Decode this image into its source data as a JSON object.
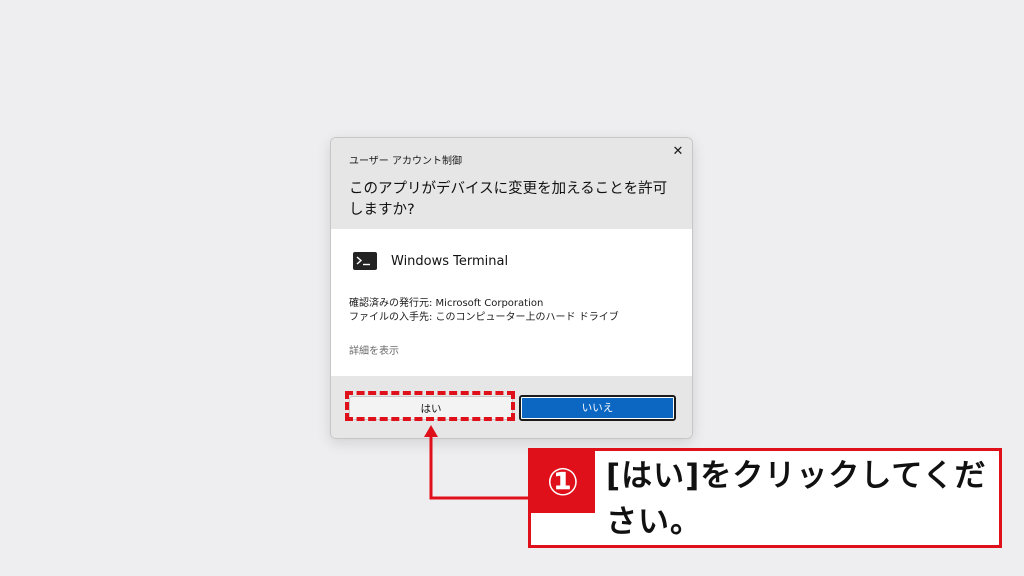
{
  "dialog": {
    "caption": "ユーザー アカウント制御",
    "close_label": "✕",
    "question": "このアプリがデバイスに変更を加えることを許可しますか?",
    "app_icon": "terminal-icon",
    "app_name": "Windows Terminal",
    "publisher_line": "確認済みの発行元: Microsoft Corporation",
    "origin_line": "ファイルの入手先: このコンピューター上のハード ドライブ",
    "details_link": "詳細を表示",
    "yes_label": "はい",
    "no_label": "いいえ"
  },
  "annotation": {
    "step_number": "①",
    "instruction": "[はい]をクリックしてください。",
    "accent_color": "#e0101a"
  },
  "colors": {
    "primary_button": "#0b67c2",
    "dialog_header": "#e6e6e6",
    "page_background": "#eeeef0"
  }
}
